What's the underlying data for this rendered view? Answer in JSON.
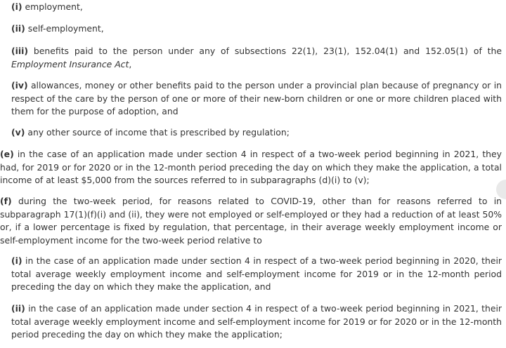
{
  "items": [
    {
      "label": "(i)",
      "text": " employment,"
    },
    {
      "label": "(ii)",
      "text": " self-employment,"
    },
    {
      "label": "(iii)",
      "text": " benefits paid to the person under any of subsections 22(1), 23(1), 152.04(1) and 152.05(1) of the ",
      "italic": "Employment Insurance Act",
      "tail": ","
    },
    {
      "label": "(iv)",
      "text": " allowances, money or other benefits paid to the person under a provincial plan because of pregnancy or in respect of the care by the person of one or more of their new-born children or one or more children placed with them for the purpose of adoption, and"
    },
    {
      "label": "(v)",
      "text": " any other source of income that is prescribed by regulation;"
    }
  ],
  "para_e": {
    "label": "(e)",
    "text": " in the case of an application made under section 4 in respect of a two-week period beginning in 2021, they had, for 2019 or for 2020 or in the 12-month period preceding the day on which they make the application, a total income of at least $5,000 from the sources referred to in subparagraphs (d)(i) to (v);"
  },
  "para_f": {
    "label": "(f)",
    "text": " during the two-week period, for reasons related to COVID-19, other than for reasons referred to in subparagraph 17(1)(f)(i) and (ii), they were not employed or self-employed or they had a reduction of at least 50% or, if a lower percentage is fixed by regulation, that percentage, in their average weekly employment income or self-employment income for the two-week period relative to"
  },
  "sub_i": {
    "label": "(i)",
    "text": " in the case of an application made under section 4 in respect of a two-week period beginning in 2020, their total average weekly employment income and self-employment income for 2019 or in the 12-month period preceding the day on which they make the application, and"
  },
  "sub_ii": {
    "label": "(ii)",
    "text": " in the case of an application made under section 4 in respect of a two-week period beginning in 2021, their total average weekly employment income and self-employment income for 2019 or for 2020 or in the 12-month period preceding the day on which they make the application;"
  }
}
